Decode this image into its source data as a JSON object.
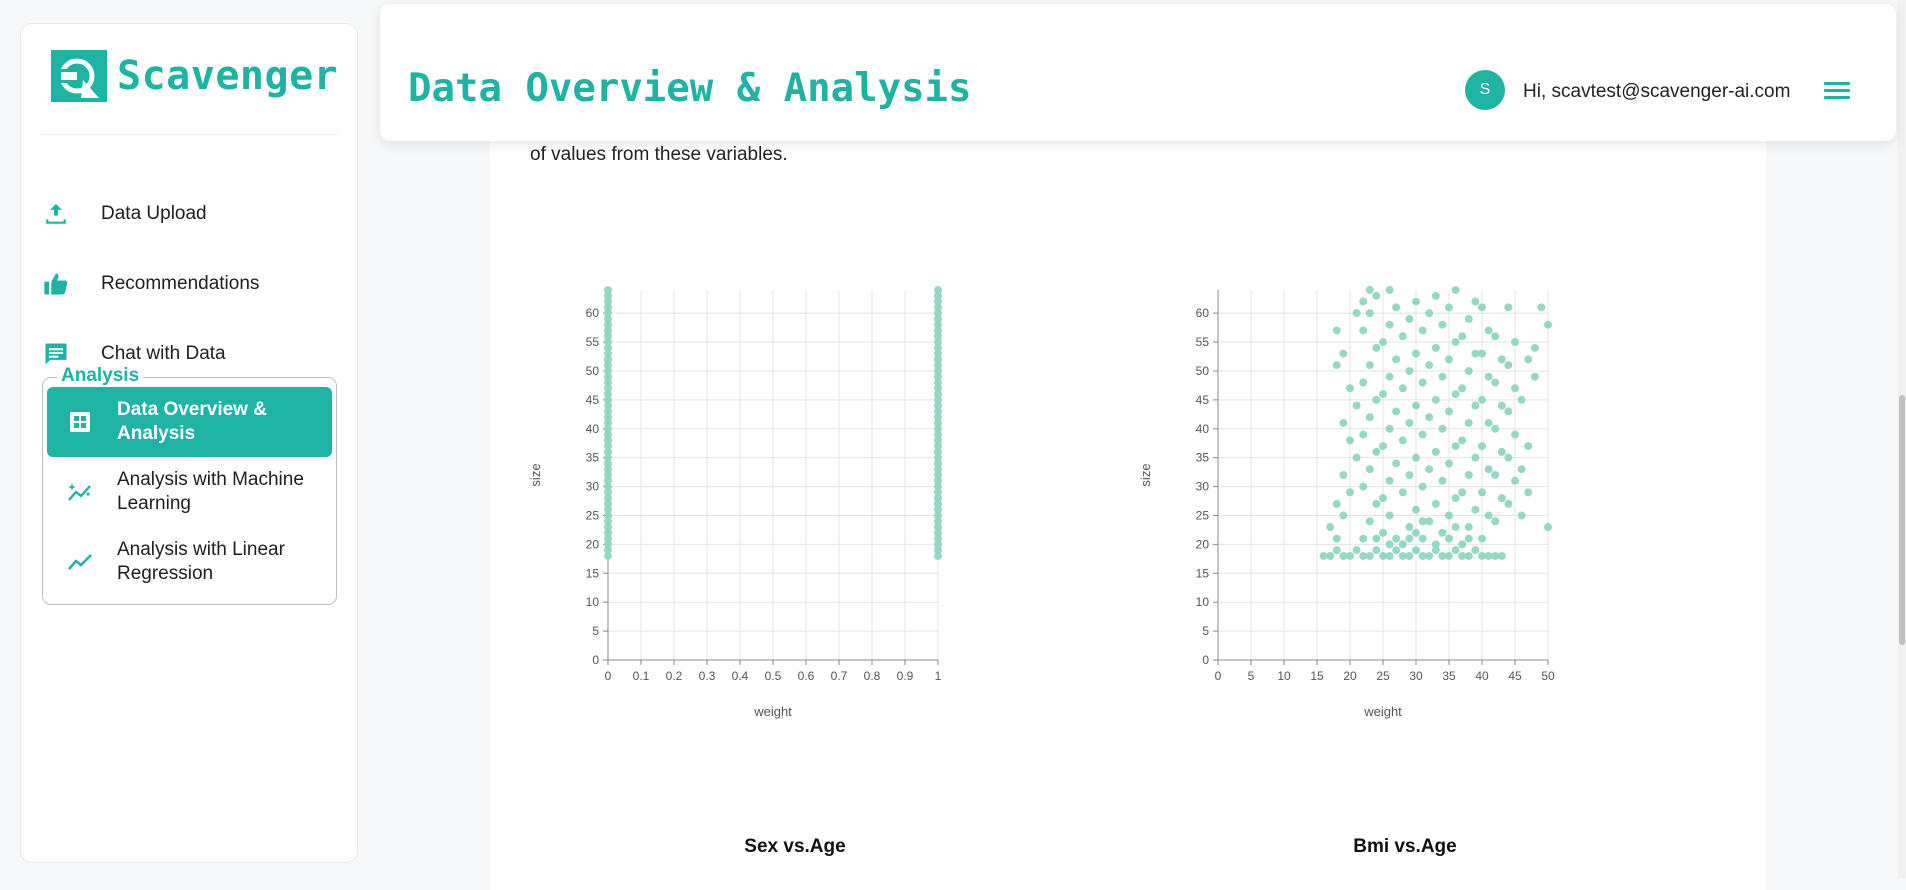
{
  "app": {
    "name": "Scavenger"
  },
  "sidebar": {
    "items": [
      {
        "label": "Data Upload",
        "icon": "upload-icon"
      },
      {
        "label": "Recommendations",
        "icon": "thumbs-up-icon"
      },
      {
        "label": "Chat with Data",
        "icon": "chat-icon"
      }
    ],
    "analysis_group": {
      "title": "Analysis",
      "items": [
        {
          "label": "Data Overview & Analysis",
          "icon": "dashboard-icon",
          "active": true
        },
        {
          "label": "Analysis with Machine Learning",
          "icon": "sparkle-chart-icon",
          "active": false
        },
        {
          "label": "Analysis with Linear Regression",
          "icon": "trend-line-icon",
          "active": false
        }
      ]
    }
  },
  "header": {
    "title": "Data Overview & Analysis",
    "avatar_letter": "S",
    "greeting": "Hi, scavtest@scavenger-ai.com"
  },
  "content": {
    "intro_text": "of values from these variables."
  },
  "colors": {
    "accent": "#1fb3a4",
    "point": "#8fd6c2",
    "grid": "#e3e3e3"
  },
  "chart_data": [
    {
      "type": "scatter",
      "title": "Sex vs.Age",
      "xlabel": "weight",
      "ylabel": "size",
      "xlim": [
        0,
        1
      ],
      "ylim": [
        0,
        64
      ],
      "xticks": [
        0,
        0.1,
        0.2,
        0.3,
        0.4,
        0.5,
        0.6,
        0.7,
        0.8,
        0.9,
        1
      ],
      "yticks": [
        0,
        5,
        10,
        15,
        20,
        25,
        30,
        35,
        40,
        45,
        50,
        55,
        60
      ],
      "points": [
        [
          0,
          18
        ],
        [
          0,
          19
        ],
        [
          0,
          20
        ],
        [
          0,
          21
        ],
        [
          0,
          22
        ],
        [
          0,
          23
        ],
        [
          0,
          24
        ],
        [
          0,
          25
        ],
        [
          0,
          26
        ],
        [
          0,
          27
        ],
        [
          0,
          28
        ],
        [
          0,
          29
        ],
        [
          0,
          30
        ],
        [
          0,
          31
        ],
        [
          0,
          32
        ],
        [
          0,
          33
        ],
        [
          0,
          34
        ],
        [
          0,
          35
        ],
        [
          0,
          36
        ],
        [
          0,
          37
        ],
        [
          0,
          38
        ],
        [
          0,
          39
        ],
        [
          0,
          40
        ],
        [
          0,
          41
        ],
        [
          0,
          42
        ],
        [
          0,
          43
        ],
        [
          0,
          44
        ],
        [
          0,
          45
        ],
        [
          0,
          46
        ],
        [
          0,
          47
        ],
        [
          0,
          48
        ],
        [
          0,
          49
        ],
        [
          0,
          50
        ],
        [
          0,
          51
        ],
        [
          0,
          52
        ],
        [
          0,
          53
        ],
        [
          0,
          54
        ],
        [
          0,
          55
        ],
        [
          0,
          56
        ],
        [
          0,
          57
        ],
        [
          0,
          58
        ],
        [
          0,
          59
        ],
        [
          0,
          60
        ],
        [
          0,
          61
        ],
        [
          0,
          62
        ],
        [
          0,
          63
        ],
        [
          0,
          64
        ],
        [
          1,
          18
        ],
        [
          1,
          19
        ],
        [
          1,
          20
        ],
        [
          1,
          21
        ],
        [
          1,
          22
        ],
        [
          1,
          23
        ],
        [
          1,
          24
        ],
        [
          1,
          25
        ],
        [
          1,
          26
        ],
        [
          1,
          27
        ],
        [
          1,
          28
        ],
        [
          1,
          29
        ],
        [
          1,
          30
        ],
        [
          1,
          31
        ],
        [
          1,
          32
        ],
        [
          1,
          33
        ],
        [
          1,
          34
        ],
        [
          1,
          35
        ],
        [
          1,
          36
        ],
        [
          1,
          37
        ],
        [
          1,
          38
        ],
        [
          1,
          39
        ],
        [
          1,
          40
        ],
        [
          1,
          41
        ],
        [
          1,
          42
        ],
        [
          1,
          43
        ],
        [
          1,
          44
        ],
        [
          1,
          45
        ],
        [
          1,
          46
        ],
        [
          1,
          47
        ],
        [
          1,
          48
        ],
        [
          1,
          49
        ],
        [
          1,
          50
        ],
        [
          1,
          51
        ],
        [
          1,
          52
        ],
        [
          1,
          53
        ],
        [
          1,
          54
        ],
        [
          1,
          55
        ],
        [
          1,
          56
        ],
        [
          1,
          57
        ],
        [
          1,
          58
        ],
        [
          1,
          59
        ],
        [
          1,
          60
        ],
        [
          1,
          61
        ],
        [
          1,
          62
        ],
        [
          1,
          63
        ],
        [
          1,
          64
        ]
      ]
    },
    {
      "type": "scatter",
      "title": "Bmi vs.Age",
      "xlabel": "weight",
      "ylabel": "size",
      "xlim": [
        0,
        50
      ],
      "ylim": [
        0,
        64
      ],
      "xticks": [
        0,
        5,
        10,
        15,
        20,
        25,
        30,
        35,
        40,
        45,
        50
      ],
      "yticks": [
        0,
        5,
        10,
        15,
        20,
        25,
        30,
        35,
        40,
        45,
        50,
        55,
        60
      ],
      "points": [
        [
          16,
          18
        ],
        [
          17,
          18
        ],
        [
          18,
          19
        ],
        [
          19,
          18
        ],
        [
          20,
          18
        ],
        [
          21,
          19
        ],
        [
          22,
          18
        ],
        [
          23,
          18
        ],
        [
          24,
          19
        ],
        [
          25,
          18
        ],
        [
          26,
          18
        ],
        [
          27,
          19
        ],
        [
          28,
          18
        ],
        [
          29,
          18
        ],
        [
          30,
          19
        ],
        [
          31,
          18
        ],
        [
          32,
          18
        ],
        [
          33,
          19
        ],
        [
          34,
          18
        ],
        [
          35,
          18
        ],
        [
          36,
          19
        ],
        [
          37,
          18
        ],
        [
          38,
          18
        ],
        [
          39,
          19
        ],
        [
          40,
          18
        ],
        [
          41,
          18
        ],
        [
          42,
          18
        ],
        [
          43,
          18
        ],
        [
          18,
          21
        ],
        [
          17,
          23
        ],
        [
          19,
          25
        ],
        [
          18,
          27
        ],
        [
          20,
          29
        ],
        [
          19,
          32
        ],
        [
          21,
          35
        ],
        [
          20,
          38
        ],
        [
          19,
          41
        ],
        [
          21,
          44
        ],
        [
          20,
          47
        ],
        [
          18,
          51
        ],
        [
          19,
          53
        ],
        [
          18,
          57
        ],
        [
          21,
          60
        ],
        [
          22,
          62
        ],
        [
          23,
          64
        ],
        [
          22,
          21
        ],
        [
          23,
          24
        ],
        [
          24,
          27
        ],
        [
          22,
          30
        ],
        [
          23,
          33
        ],
        [
          24,
          36
        ],
        [
          22,
          39
        ],
        [
          23,
          42
        ],
        [
          24,
          45
        ],
        [
          22,
          48
        ],
        [
          23,
          51
        ],
        [
          24,
          54
        ],
        [
          22,
          57
        ],
        [
          23,
          60
        ],
        [
          24,
          63
        ],
        [
          25,
          22
        ],
        [
          26,
          25
        ],
        [
          25,
          28
        ],
        [
          26,
          31
        ],
        [
          27,
          34
        ],
        [
          25,
          37
        ],
        [
          26,
          40
        ],
        [
          27,
          43
        ],
        [
          25,
          46
        ],
        [
          26,
          49
        ],
        [
          27,
          52
        ],
        [
          25,
          55
        ],
        [
          26,
          58
        ],
        [
          27,
          61
        ],
        [
          26,
          64
        ],
        [
          28,
          20
        ],
        [
          29,
          23
        ],
        [
          30,
          26
        ],
        [
          28,
          29
        ],
        [
          29,
          32
        ],
        [
          30,
          35
        ],
        [
          28,
          38
        ],
        [
          29,
          41
        ],
        [
          30,
          44
        ],
        [
          28,
          47
        ],
        [
          29,
          50
        ],
        [
          30,
          53
        ],
        [
          28,
          56
        ],
        [
          29,
          59
        ],
        [
          30,
          62
        ],
        [
          31,
          21
        ],
        [
          32,
          24
        ],
        [
          33,
          27
        ],
        [
          31,
          30
        ],
        [
          32,
          33
        ],
        [
          33,
          36
        ],
        [
          31,
          39
        ],
        [
          32,
          42
        ],
        [
          33,
          45
        ],
        [
          31,
          48
        ],
        [
          32,
          51
        ],
        [
          33,
          54
        ],
        [
          31,
          57
        ],
        [
          32,
          60
        ],
        [
          33,
          63
        ],
        [
          34,
          22
        ],
        [
          35,
          25
        ],
        [
          36,
          28
        ],
        [
          34,
          31
        ],
        [
          35,
          34
        ],
        [
          36,
          37
        ],
        [
          34,
          40
        ],
        [
          35,
          43
        ],
        [
          36,
          46
        ],
        [
          34,
          49
        ],
        [
          35,
          52
        ],
        [
          36,
          55
        ],
        [
          34,
          58
        ],
        [
          35,
          61
        ],
        [
          36,
          64
        ],
        [
          37,
          20
        ],
        [
          38,
          23
        ],
        [
          39,
          26
        ],
        [
          37,
          29
        ],
        [
          38,
          32
        ],
        [
          39,
          35
        ],
        [
          37,
          38
        ],
        [
          38,
          41
        ],
        [
          39,
          44
        ],
        [
          37,
          47
        ],
        [
          38,
          50
        ],
        [
          39,
          53
        ],
        [
          37,
          56
        ],
        [
          38,
          59
        ],
        [
          39,
          62
        ],
        [
          40,
          21
        ],
        [
          41,
          25
        ],
        [
          40,
          29
        ],
        [
          41,
          33
        ],
        [
          40,
          37
        ],
        [
          41,
          41
        ],
        [
          40,
          45
        ],
        [
          41,
          49
        ],
        [
          40,
          53
        ],
        [
          41,
          57
        ],
        [
          40,
          61
        ],
        [
          42,
          24
        ],
        [
          43,
          28
        ],
        [
          42,
          32
        ],
        [
          43,
          36
        ],
        [
          42,
          40
        ],
        [
          43,
          44
        ],
        [
          42,
          48
        ],
        [
          43,
          52
        ],
        [
          42,
          56
        ],
        [
          44,
          27
        ],
        [
          45,
          31
        ],
        [
          44,
          35
        ],
        [
          45,
          39
        ],
        [
          44,
          43
        ],
        [
          45,
          47
        ],
        [
          44,
          51
        ],
        [
          45,
          55
        ],
        [
          46,
          25
        ],
        [
          47,
          29
        ],
        [
          46,
          33
        ],
        [
          47,
          37
        ],
        [
          46,
          45
        ],
        [
          47,
          52
        ],
        [
          48,
          49
        ],
        [
          48,
          54
        ],
        [
          49,
          61
        ],
        [
          50,
          58
        ],
        [
          50,
          23
        ],
        [
          44,
          61
        ],
        [
          29,
          21
        ],
        [
          30,
          22
        ],
        [
          31,
          24
        ],
        [
          33,
          20
        ],
        [
          35,
          21
        ],
        [
          36,
          23
        ],
        [
          38,
          21
        ],
        [
          27,
          21
        ],
        [
          26,
          20
        ],
        [
          24,
          21
        ]
      ]
    }
  ]
}
